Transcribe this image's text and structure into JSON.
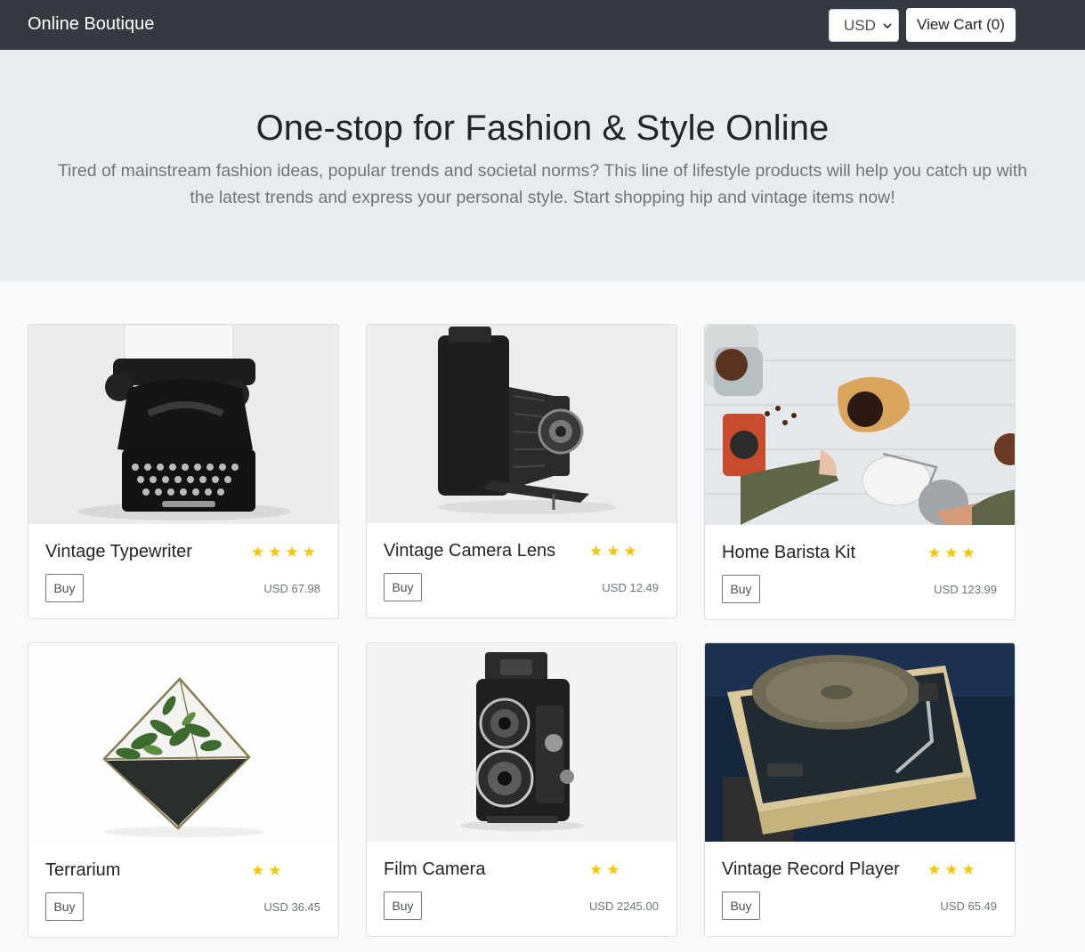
{
  "navbar": {
    "brand": "Online Boutique",
    "currency": {
      "selected": "USD"
    },
    "cart_label": "View Cart (0)"
  },
  "hero": {
    "title": "One-stop for Fashion & Style Online",
    "description": "Tired of mainstream fashion ideas, popular trends and societal norms? This line of lifestyle products will help you catch up with the latest trends and express your personal style. Start shopping hip and vintage items now!"
  },
  "buy_label": "Buy",
  "products": [
    {
      "name": "Vintage Typewriter",
      "rating": 4,
      "stars": "★★★★",
      "price": "USD 67.98",
      "image": "typewriter-image"
    },
    {
      "name": "Vintage Camera Lens",
      "rating": 3,
      "stars": "★★★",
      "price": "USD 12.49",
      "image": "folding-camera-image"
    },
    {
      "name": "Home Barista Kit",
      "rating": 3,
      "stars": "★★★",
      "price": "USD 123.99",
      "image": "coffee-pour-over-image"
    },
    {
      "name": "Terrarium",
      "rating": 2,
      "stars": "★★",
      "price": "USD 36.45",
      "image": "terrarium-image"
    },
    {
      "name": "Film Camera",
      "rating": 2,
      "stars": "★★",
      "price": "USD 2245.00",
      "image": "twin-lens-camera-image"
    },
    {
      "name": "Vintage Record Player",
      "rating": 3,
      "stars": "★★★",
      "price": "USD 65.49",
      "image": "record-player-image"
    }
  ]
}
